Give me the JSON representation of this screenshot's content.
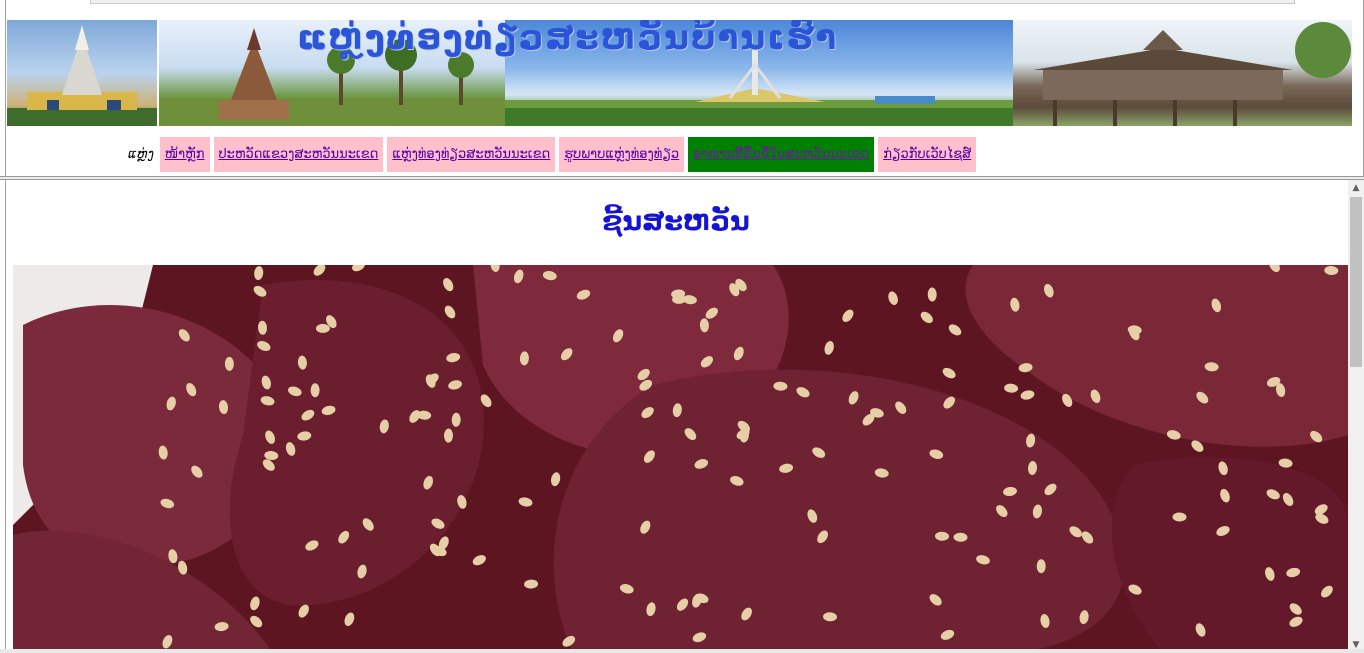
{
  "banner": {
    "title": "ແຫຼ່ງທ່ອງທ່ຽວສະຫວັນບ້ານເຮົາ",
    "images": [
      "city-monument-photo",
      "temple-palm-photo",
      "monument-park-photo",
      "wooden-pavilion-photo"
    ]
  },
  "nav": {
    "label": "ແຫຼ່ງ",
    "items": [
      {
        "label": "ໜ້າຫຼັກ",
        "active": false
      },
      {
        "label": "ປະຫວັດແຂວງສະຫວັນນະເຂດ",
        "active": false
      },
      {
        "label": "ແຫຼ່ງທ່ອງທ່ຽວສະຫວັນນະເຂດ",
        "active": false
      },
      {
        "label": "ຮູບພາບແຫຼ່ງທ່ອງທ່ຽວ",
        "active": false
      },
      {
        "label": "ອາຫານທີ່ຂຶ້ນຊື່ໃນສະຫວັນນະເຂດ",
        "active": true
      },
      {
        "label": "ກ່ຽວກັບເວັບໄຊສ໌",
        "active": false
      }
    ]
  },
  "main": {
    "title": "ຊີ້ນສະຫວັນ",
    "photo": "dried-beef-with-sesame-photo"
  },
  "colors": {
    "nav_bg": "#ffc0cb",
    "nav_active_bg": "#008000",
    "nav_link": "#5500aa",
    "title": "#1414d2",
    "banner_title": "#2a55d8"
  },
  "scrollbar": {
    "up_icon": "▲",
    "down_icon": "▼"
  }
}
